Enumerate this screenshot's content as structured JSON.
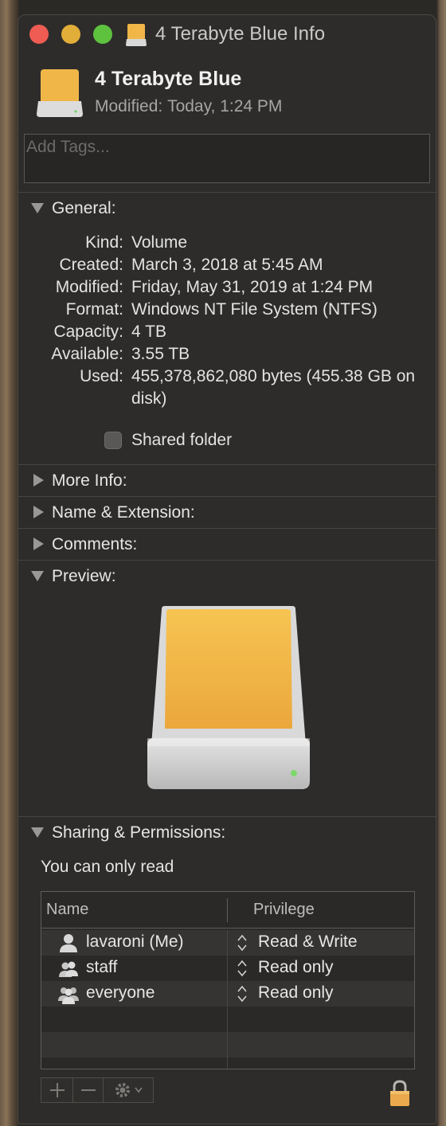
{
  "window": {
    "title": "4 Terabyte Blue Info"
  },
  "header": {
    "name": "4 Terabyte Blue",
    "modified_label": "Modified:",
    "modified_value": "Today, 1:24 PM"
  },
  "tags": {
    "placeholder": "Add Tags..."
  },
  "sections": {
    "general": "General:",
    "more_info": "More Info:",
    "name_extension": "Name & Extension:",
    "comments": "Comments:",
    "preview": "Preview:",
    "sharing": "Sharing & Permissions:"
  },
  "general": {
    "rows": [
      {
        "key": "Kind:",
        "value": "Volume"
      },
      {
        "key": "Created:",
        "value": "March 3, 2018 at 5:45 AM"
      },
      {
        "key": "Modified:",
        "value": "Friday, May 31, 2019 at 1:24 PM"
      },
      {
        "key": "Format:",
        "value": "Windows NT File System (NTFS)"
      },
      {
        "key": "Capacity:",
        "value": "4 TB"
      },
      {
        "key": "Available:",
        "value": "3.55 TB"
      },
      {
        "key": "Used:",
        "value": "455,378,862,080 bytes (455.38 GB on disk)"
      }
    ],
    "shared_folder_label": "Shared folder",
    "shared_folder_checked": false
  },
  "sharing": {
    "note": "You can only read",
    "columns": {
      "name": "Name",
      "privilege": "Privilege"
    },
    "rows": [
      {
        "user": "lavaroni (Me)",
        "privilege": "Read & Write",
        "icon": "single-user-icon"
      },
      {
        "user": "staff",
        "privilege": "Read only",
        "icon": "group-icon"
      },
      {
        "user": "everyone",
        "privilege": "Read only",
        "icon": "everyone-icon"
      }
    ]
  },
  "icons": {
    "window_icon": "drive-icon",
    "lock": "lock-icon",
    "add": "plus-icon",
    "remove": "minus-icon",
    "action": "gear-icon"
  },
  "colors": {
    "drive_orange": "#f0b648",
    "close": "#ee5c53",
    "minimize": "#e2ae3a",
    "zoom": "#5ec23f",
    "lock": "#e9a94c"
  }
}
